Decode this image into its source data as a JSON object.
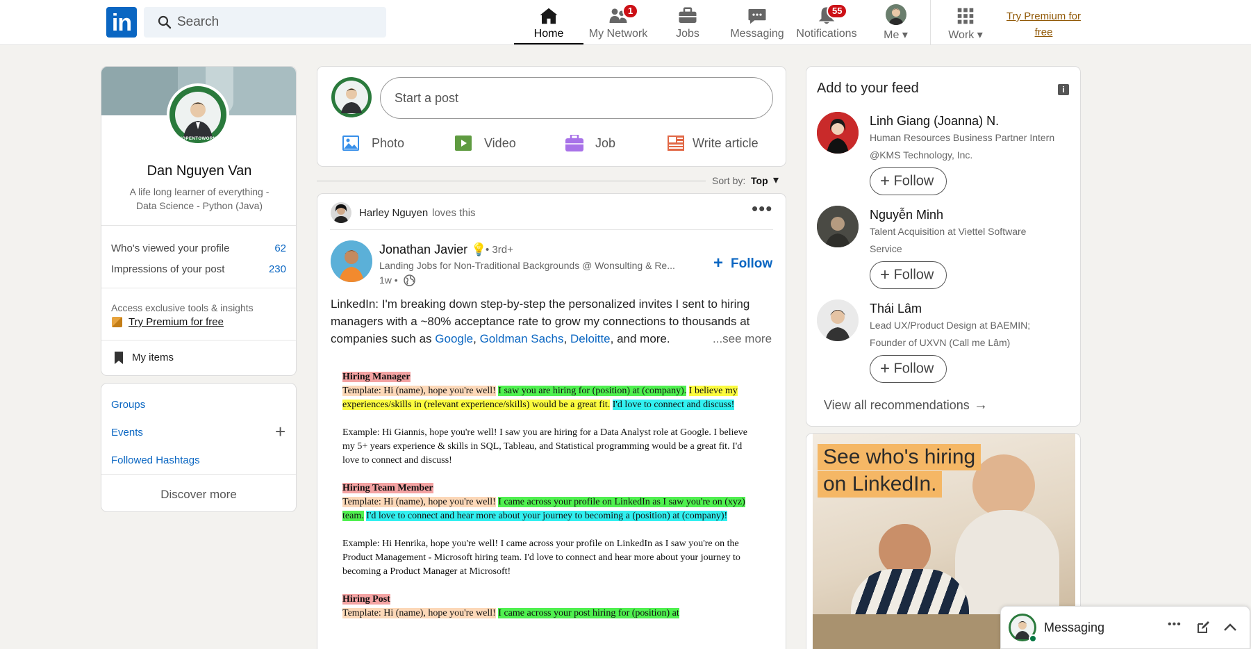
{
  "header": {
    "search_placeholder": "Search",
    "nav": [
      {
        "label": "Home",
        "icon": "home-icon",
        "badge": ""
      },
      {
        "label": "My Network",
        "icon": "network-icon",
        "badge": "1"
      },
      {
        "label": "Jobs",
        "icon": "briefcase-icon",
        "badge": ""
      },
      {
        "label": "Messaging",
        "icon": "chat-icon",
        "badge": ""
      },
      {
        "label": "Notifications",
        "icon": "bell-icon",
        "badge": "55"
      },
      {
        "label": "Me",
        "icon": "avatar",
        "badge": ""
      },
      {
        "label": "Work",
        "icon": "grid-icon",
        "badge": ""
      }
    ],
    "premium_line1": "Try Premium for",
    "premium_line2": "free"
  },
  "profile": {
    "name": "Dan Nguyen Van",
    "headline_line1": "A life long learner of everything -",
    "headline_line2": "Data Science - Python (Java)",
    "avatar_text": "#OPENTOWORK",
    "stats": [
      {
        "label": "Who's viewed your profile",
        "value": "62"
      },
      {
        "label": "Impressions of your post",
        "value": "230"
      }
    ],
    "premium_prompt": "Access exclusive tools & insights",
    "premium_link": "Try Premium for free",
    "my_items": "My items"
  },
  "shortcuts": {
    "groups": "Groups",
    "events": "Events",
    "hashtags": "Followed Hashtags",
    "discover": "Discover more"
  },
  "composer": {
    "placeholder": "Start a post",
    "actions": [
      {
        "label": "Photo",
        "color": "#378fe9"
      },
      {
        "label": "Video",
        "color": "#5f9b41"
      },
      {
        "label": "Job",
        "color": "#a872e8"
      },
      {
        "label": "Write article",
        "color": "#e16745"
      }
    ]
  },
  "sort": {
    "label": "Sort by:",
    "value": "Top"
  },
  "post": {
    "activity_user": "Harley Nguyen",
    "activity_action": "loves this",
    "author": "Jonathan Javier",
    "author_emoji": "💡",
    "degree": "• 3rd+",
    "author_headline": "Landing Jobs for Non-Traditional Backgrounds @ Wonsulting & Re...",
    "time": "1w •",
    "follow_label": "Follow",
    "text_line1": "LinkedIn: I'm breaking down step-by-step the personalized invites I sent to hiring",
    "text_line2": "managers with a ~80% acceptance rate to grow my connections to thousands at",
    "text_line3_prefix": "companies such as",
    "company1": "Google",
    "comma1": ",",
    "company2": "Goldman Sachs",
    "comma2": ",",
    "company3": "Deloitte",
    "text_line3_suffix": ", and more.",
    "see_more": "...see more",
    "image": {
      "h1": "Hiring Manager",
      "t1_a": "Template: Hi (name), hope you're well!",
      "t1_b": "I saw you are hiring for (position) at (company).",
      "t1_c": "I believe my experiences/skills in (relevant experience/skills) would be a great fit.",
      "t1_d": "I'd love to connect and discuss!",
      "e1": "Example: Hi Giannis, hope you're well! I saw you are hiring for a Data Analyst role at Google. I believe my 5+ years experience & skills in SQL, Tableau, and Statistical programming would be a great fit. I'd love to connect and discuss!",
      "h2": "Hiring Team Member",
      "t2_a": "Template: Hi (name), hope you're well!",
      "t2_b": "I came across your profile on LinkedIn as I saw you're on (xyz) team.",
      "t2_c": "I'd love to connect and hear more about your journey to becoming a (position) at (company)!",
      "e2": "Example: Hi Henrika, hope you're well! I came across your profile on LinkedIn as I saw you're on the Product Management - Microsoft hiring team. I'd love to connect and hear more about your journey to becoming a Product Manager at Microsoft!",
      "h3": "Hiring Post",
      "t3_a": "Template: Hi (name), hope you're well!",
      "t3_b": "I came across your post hiring for (position) at"
    }
  },
  "feed": {
    "title": "Add to your feed",
    "people": [
      {
        "name": "Linh Giang (Joanna) N.",
        "line1": "Human Resources Business Partner Intern",
        "line2": "@KMS Technology, Inc.",
        "follow": "Follow"
      },
      {
        "name": "Nguyễn Minh",
        "line1": "Talent Acquisition at Viettel Software",
        "line2": "Service",
        "follow": "Follow"
      },
      {
        "name": "Thái Lâm",
        "line1": "Lead UX/Product Design at BAEMIN;",
        "line2": "Founder of UXVN (Call me Lâm)",
        "follow": "Follow"
      }
    ],
    "view_all": "View all recommendations"
  },
  "ad": {
    "line1": "See who's hiring",
    "line2": "on LinkedIn."
  },
  "messaging": {
    "label": "Messaging"
  },
  "colors": {
    "brand": "#0a66c2",
    "badge": "#cc1016",
    "premium": "#915907"
  }
}
